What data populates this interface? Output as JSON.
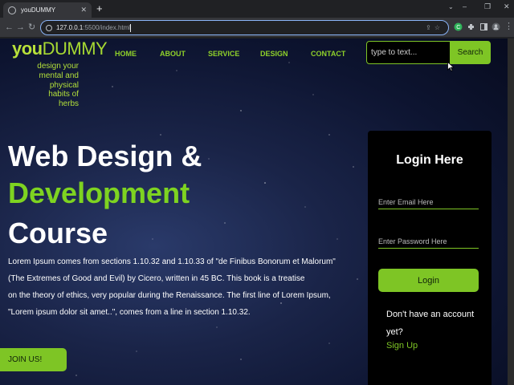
{
  "browser": {
    "tab_title": "youDUMMY",
    "new_tab": "+",
    "window_controls": [
      "⌄",
      "–",
      "❐",
      "✕"
    ],
    "url_host": "127.0.0.1",
    "url_rest": ":5500/index.html"
  },
  "site": {
    "logo_you": "you",
    "logo_dummy": "DUMMY",
    "tagline": "design your mental and physical habits of herbs",
    "nav": [
      "HOME",
      "ABOUT",
      "SERVICE",
      "DESIGN",
      "CONTACT"
    ],
    "search_placeholder": "type to text...",
    "search_button": "Search"
  },
  "hero": {
    "line1": "Web Design &",
    "line2": "Development",
    "line3": "Course",
    "paragraph_lines": [
      "Lorem Ipsum comes from sections 1.10.32 and 1.10.33 of \"de Finibus Bonorum et Malorum\"",
      "(The Extremes of Good and Evil) by Cicero, written in 45 BC. This book is a treatise",
      "on the theory of ethics, very popular during the Renaissance. The first line of Lorem Ipsum,",
      "\"Lorem ipsum dolor sit amet..\", comes from a line in section 1.10.32."
    ],
    "join_button": "JOIN US!"
  },
  "login": {
    "title": "Login Here",
    "email_placeholder": "Enter Email Here",
    "password_placeholder": "Enter Password Here",
    "login_button": "Login",
    "no_account": "Don't have an account yet?",
    "signup": "Sign Up"
  },
  "colors": {
    "accent": "#7ec525",
    "logo": "#b8e03a",
    "card": "#000000"
  }
}
